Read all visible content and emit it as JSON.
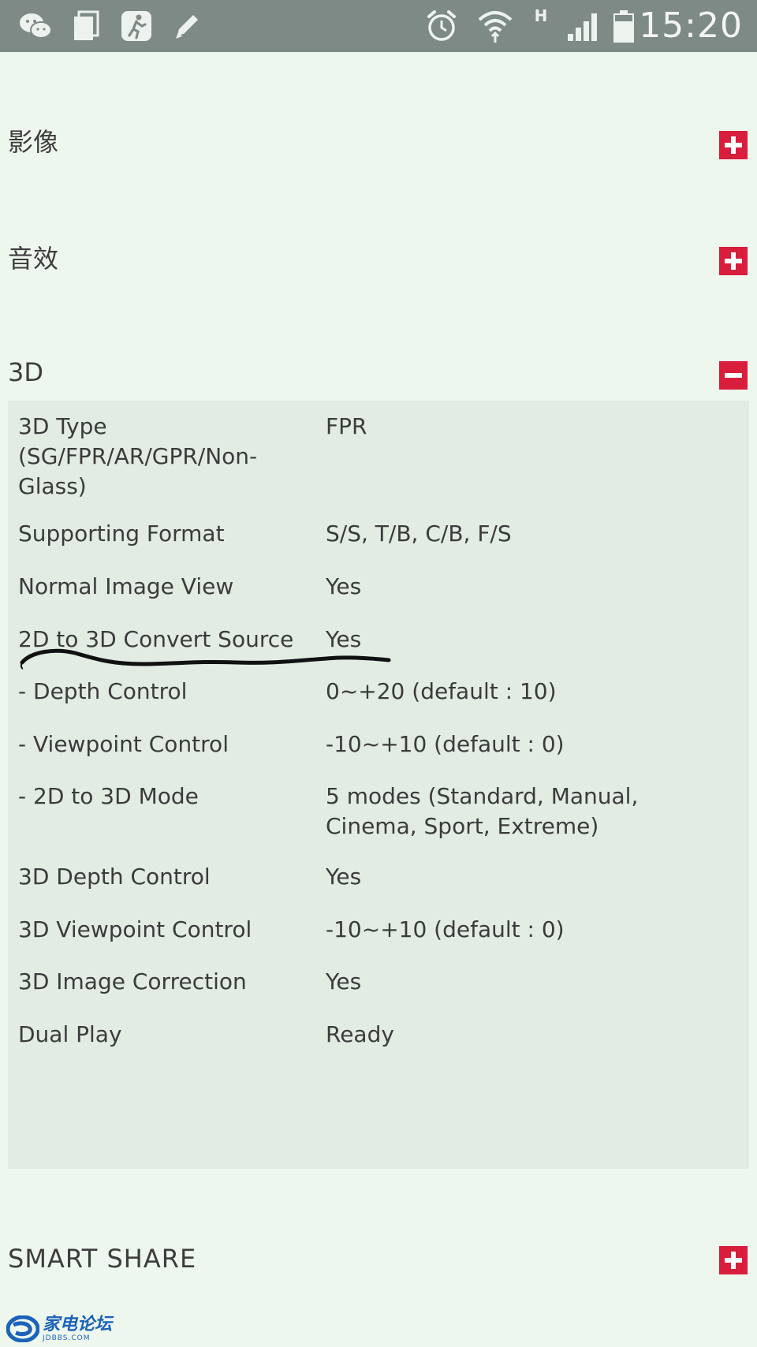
{
  "status_bar": {
    "time": "15:20",
    "network_type": "H",
    "left_icons": [
      "wechat-icon",
      "documents-icon",
      "running-man-icon",
      "pencil-icon"
    ],
    "right_icons": [
      "alarm-clock-icon",
      "wifi-icon",
      "signal-icon",
      "battery-icon"
    ]
  },
  "sections": {
    "image": {
      "title": "影像",
      "state": "collapsed"
    },
    "audio": {
      "title": "音效",
      "state": "collapsed"
    },
    "three_d": {
      "title": "3D",
      "state": "expanded"
    },
    "smart_share": {
      "title": "SMART SHARE",
      "state": "collapsed"
    }
  },
  "spec_rows": [
    {
      "label": "3D Type (SG/FPR/AR/GPR/Non-Glass)",
      "value": "FPR"
    },
    {
      "label": "Supporting Format",
      "value": "S/S, T/B, C/B, F/S"
    },
    {
      "label": "Normal Image View",
      "value": "Yes"
    },
    {
      "label": "2D to 3D Convert Source",
      "value": "Yes"
    },
    {
      "label": "- Depth Control",
      "value": "0~+20 (default : 10)"
    },
    {
      "label": "- Viewpoint Control",
      "value": "-10~+10 (default : 0)"
    },
    {
      "label": "- 2D to 3D Mode",
      "value": "5 modes (Standard, Manual, Cinema, Sport, Extreme)"
    },
    {
      "label": "3D Depth Control",
      "value": "Yes"
    },
    {
      "label": "3D Viewpoint Control",
      "value": "-10~+10 (default : 0)"
    },
    {
      "label": "3D Image Correction",
      "value": "Yes"
    },
    {
      "label": "Dual Play",
      "value": "Ready"
    }
  ],
  "watermark": {
    "name": "家电论坛",
    "domain": "JDBBS.COM"
  },
  "colors": {
    "status_bar": "#7d8a86",
    "background": "#eef7ee",
    "panel": "#e2ece3",
    "accent_red": "#d81e3c",
    "watermark_blue": "#1b63b8"
  }
}
